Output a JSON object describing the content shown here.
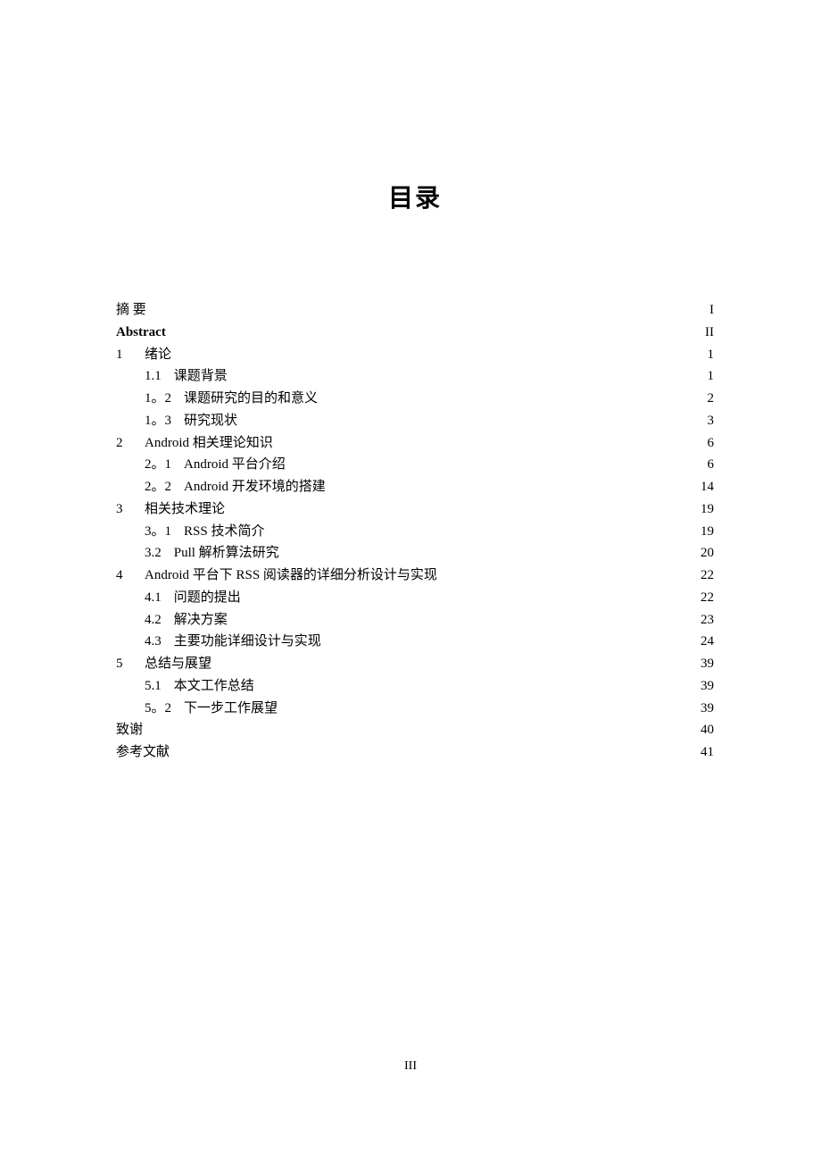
{
  "title": "目录",
  "footer": "III",
  "entries": [
    {
      "level": 0,
      "num": "",
      "label": "摘   要",
      "page": "I",
      "cls": ""
    },
    {
      "level": 0,
      "num": "",
      "label": "Abstract",
      "page": "II",
      "cls": "abstract-label"
    },
    {
      "level": 0,
      "num": "1",
      "label": "绪论",
      "page": "1",
      "cls": ""
    },
    {
      "level": 1,
      "num": "1.1",
      "label": "课题背景",
      "page": "1",
      "cls": ""
    },
    {
      "level": 1,
      "num": "1。2",
      "label": "课题研究的目的和意义",
      "page": "2",
      "cls": ""
    },
    {
      "level": 1,
      "num": "1。3",
      "label": "研究现状",
      "page": "3",
      "cls": ""
    },
    {
      "level": 0,
      "num": "2",
      "label": "Android 相关理论知识",
      "page": "6",
      "cls": ""
    },
    {
      "level": 1,
      "num": "2。1",
      "label": "Android 平台介绍",
      "page": "6",
      "cls": ""
    },
    {
      "level": 1,
      "num": "2。2",
      "label": "Android 开发环境的搭建",
      "page": "14",
      "cls": ""
    },
    {
      "level": 0,
      "num": "3",
      "label": "相关技术理论",
      "page": "19",
      "cls": ""
    },
    {
      "level": 1,
      "num": "3。1",
      "label": "RSS 技术简介",
      "page": "19",
      "cls": ""
    },
    {
      "level": 1,
      "num": "3.2",
      "label": "Pull 解析算法研究",
      "page": "20",
      "cls": ""
    },
    {
      "level": 0,
      "num": "4",
      "label": "Android 平台下 RSS 阅读器的详细分析设计与实现",
      "page": "22",
      "cls": ""
    },
    {
      "level": 1,
      "num": "4.1",
      "label": "问题的提出",
      "page": "22",
      "cls": ""
    },
    {
      "level": 1,
      "num": "4.2",
      "label": "解决方案",
      "page": "23",
      "cls": ""
    },
    {
      "level": 1,
      "num": "4.3",
      "label": "主要功能详细设计与实现",
      "page": "24",
      "cls": ""
    },
    {
      "level": 0,
      "num": "5",
      "label": "总结与展望",
      "page": "39",
      "cls": ""
    },
    {
      "level": 1,
      "num": "5.1",
      "label": "本文工作总结",
      "page": "39",
      "cls": ""
    },
    {
      "level": 1,
      "num": "5。2",
      "label": "下一步工作展望",
      "page": "39",
      "cls": ""
    },
    {
      "level": 0,
      "num": "",
      "label": "致谢",
      "page": "40",
      "cls": ""
    },
    {
      "level": 0,
      "num": "",
      "label": "参考文献",
      "page": "41",
      "cls": ""
    }
  ]
}
